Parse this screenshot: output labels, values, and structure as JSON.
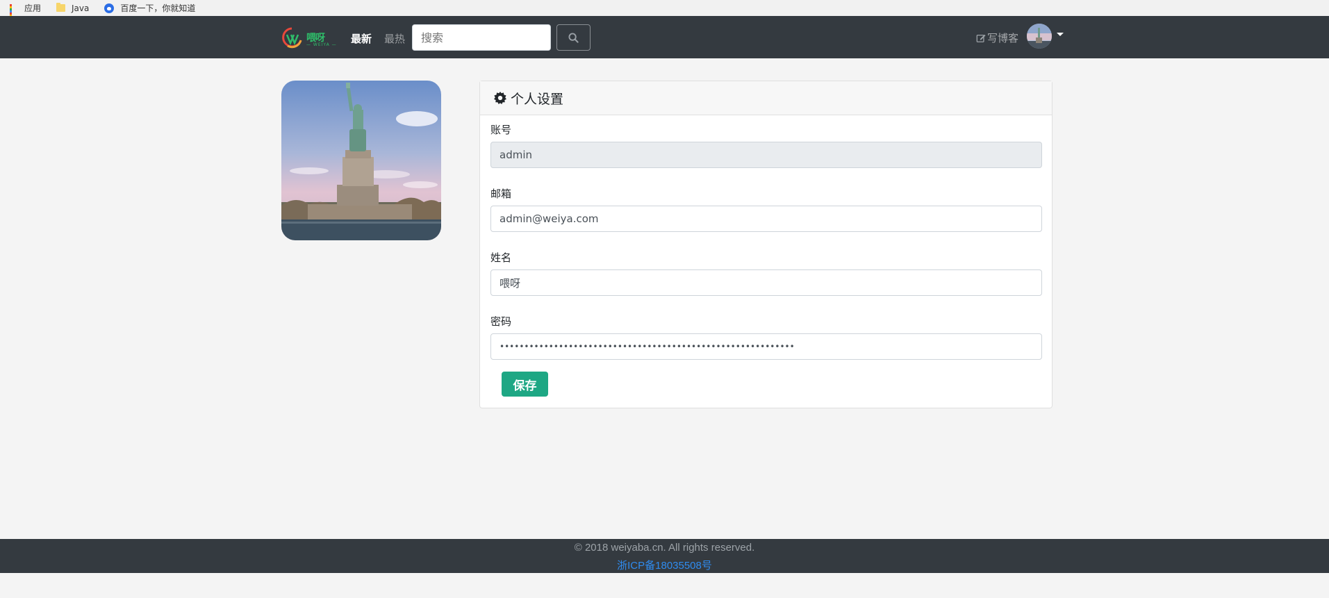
{
  "bookmarks": [
    {
      "label": "应用",
      "icon": "apps-grid-icon"
    },
    {
      "label": "Java",
      "icon": "folder-icon"
    },
    {
      "label": "百度一下，你就知道",
      "icon": "baidu-paw-icon"
    }
  ],
  "navbar": {
    "logo_text": "喂呀",
    "logo_subtext": "— WEIYA —",
    "latest_label": "最新",
    "hot_label": "最热",
    "search_placeholder": "搜索",
    "search_button_icon": "search-icon",
    "write_blog_label": "写博客",
    "background_color": "#343a40"
  },
  "settings": {
    "title": "个人设置",
    "title_icon": "gear-icon",
    "fields": [
      {
        "label": "账号",
        "value": "admin",
        "readonly": true
      },
      {
        "label": "邮箱",
        "value": "admin@weiya.com",
        "readonly": false
      },
      {
        "label": "姓名",
        "value": "喂呀",
        "readonly": false
      },
      {
        "label": "密码",
        "value": "••••••••••••••••••••••••••••••••••••••••••••••••••••••••••••",
        "readonly": false
      }
    ],
    "save_label": "保存",
    "save_color": "#1ea784"
  },
  "footer": {
    "copyright": "© 2018 weiyaba.cn. All rights reserved.",
    "icp": "浙ICP备18035508号",
    "icp_color": "#2f8cf0"
  }
}
